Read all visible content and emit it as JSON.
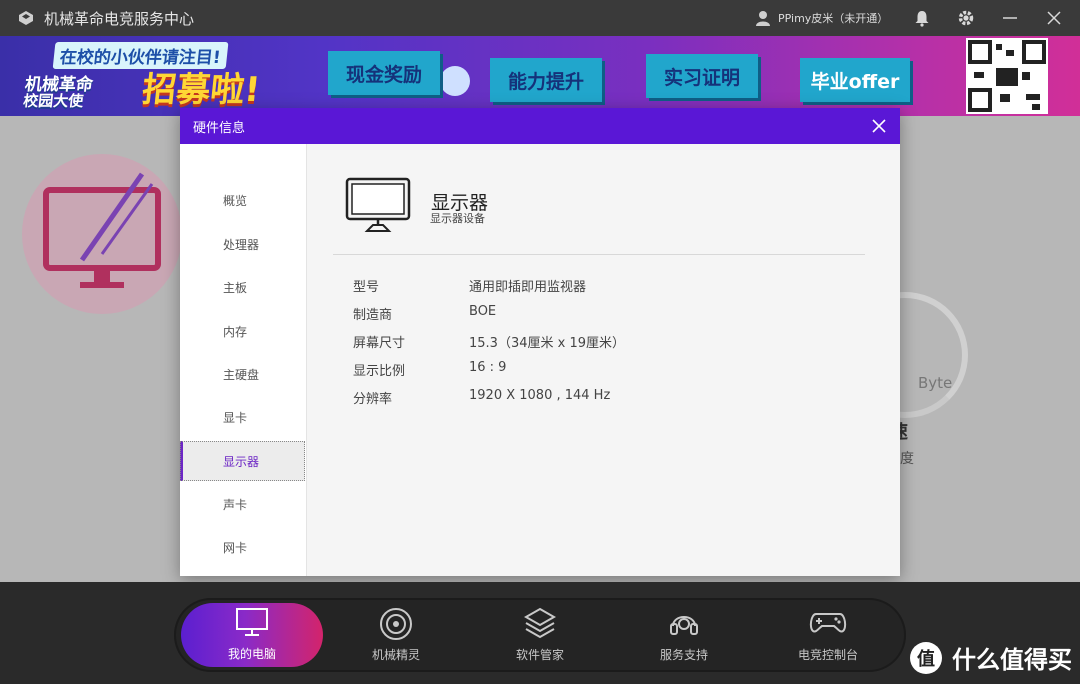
{
  "app": {
    "title": "机械革命电竞服务中心"
  },
  "user": {
    "name": "PPimy皮米（未开通）"
  },
  "banner": {
    "promo_line1": "在校的小伙伴请注目!",
    "promo_line2": "机械革命",
    "promo_line3": "校园大使",
    "promo_big": "招募啦!",
    "tags": [
      "现金奖励",
      "能力提升",
      "实习证明",
      "毕业offer"
    ]
  },
  "background": {
    "byte_label": "Byte",
    "speed_char": "速",
    "speed_label": "速度"
  },
  "modal": {
    "title": "硬件信息",
    "nav": [
      "概览",
      "处理器",
      "主板",
      "内存",
      "主硬盘",
      "显卡",
      "显示器",
      "声卡",
      "网卡"
    ],
    "active_nav_index": 6,
    "device": {
      "title": "显示器",
      "subtitle": "显示器设备",
      "icon": "monitor-icon"
    },
    "details": [
      {
        "key": "型号",
        "value": "通用即插即用监视器"
      },
      {
        "key": "制造商",
        "value": "BOE"
      },
      {
        "key": "屏幕尺寸",
        "value": "15.3（34厘米 x 19厘米）"
      },
      {
        "key": "显示比例",
        "value": "16 : 9"
      },
      {
        "key": "分辨率",
        "value": "1920 X 1080 , 144 Hz"
      }
    ]
  },
  "dock": {
    "items": [
      {
        "label": "我的电脑",
        "icon": "monitor-icon"
      },
      {
        "label": "机械精灵",
        "icon": "target-icon"
      },
      {
        "label": "软件管家",
        "icon": "layers-icon"
      },
      {
        "label": "服务支持",
        "icon": "headset-icon"
      },
      {
        "label": "电竞控制台",
        "icon": "gamepad-icon"
      }
    ],
    "active_index": 0
  },
  "watermark": {
    "text": "什么值得买",
    "mark": "值"
  },
  "colors": {
    "accent": "#5a17d6",
    "active_nav": "#6d27c5"
  }
}
